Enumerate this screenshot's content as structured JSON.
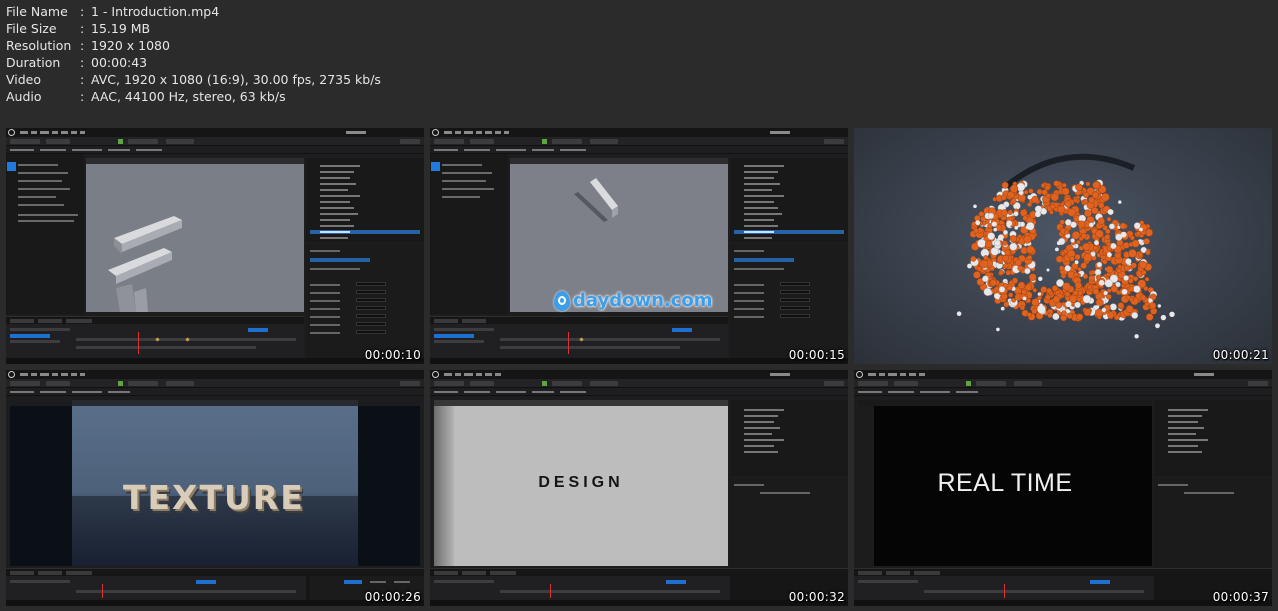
{
  "file_info": [
    {
      "key": "File Name",
      "value": "1 - Introduction.mp4"
    },
    {
      "key": "File Size",
      "value": "15.19 MB"
    },
    {
      "key": "Resolution",
      "value": "1920 x 1080"
    },
    {
      "key": "Duration",
      "value": "00:00:43"
    },
    {
      "key": "Video",
      "value": "AVC, 1920 x 1080 (16:9), 30.00 fps, 2735 kb/s"
    },
    {
      "key": "Audio",
      "value": "AAC, 44100 Hz, stereo, 63 kb/s"
    }
  ],
  "separator": ":",
  "thumbnails": [
    {
      "timestamp": "00:00:10"
    },
    {
      "timestamp": "00:00:15",
      "watermark": "daydown.com"
    },
    {
      "timestamp": "00:00:21"
    },
    {
      "timestamp": "00:00:26",
      "overlay_text": "TEXTURE"
    },
    {
      "timestamp": "00:00:32",
      "overlay_text": "DESIGN"
    },
    {
      "timestamp": "00:00:37",
      "overlay_text": "REAL TIME"
    }
  ],
  "colors": {
    "background": "#2b2b2b",
    "text": "#e6e6e6",
    "editor_panel": "#19191a",
    "accent_blue": "#1f7be0",
    "play_green": "#5fa443",
    "particles_orange": "#e0621f",
    "watermark_blue": "#3c9de8"
  }
}
